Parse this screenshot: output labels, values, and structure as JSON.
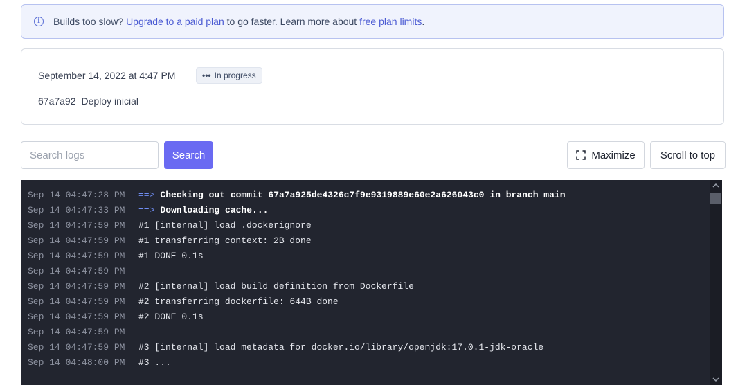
{
  "banner": {
    "prefix": "Builds too slow?",
    "upgrade_link": "Upgrade to a paid plan",
    "middle": "to go faster. Learn more about",
    "limits_link": "free plan limits",
    "suffix": "."
  },
  "deploy": {
    "date": "September 14, 2022 at 4:47 PM",
    "status_dots": "•••",
    "status": "In progress",
    "commit_hash": "67a7a92",
    "commit_message": "Deploy inicial"
  },
  "toolbar": {
    "search_placeholder": "Search logs",
    "search_value": "",
    "search_label": "Search",
    "maximize_label": "Maximize",
    "scroll_top_label": "Scroll to top"
  },
  "logs": [
    {
      "ts": "Sep 14 04:47:28 PM",
      "arrow": "==>",
      "msg": "Checking out commit 67a7a925de4326c7f9e9319889e60e2a626043c0 in branch main",
      "bold": true
    },
    {
      "ts": "Sep 14 04:47:33 PM",
      "arrow": "==>",
      "msg": "Downloading cache...",
      "bold": true
    },
    {
      "ts": "Sep 14 04:47:59 PM",
      "arrow": "",
      "msg": "#1 [internal] load .dockerignore",
      "bold": false
    },
    {
      "ts": "Sep 14 04:47:59 PM",
      "arrow": "",
      "msg": "#1 transferring context: 2B done",
      "bold": false
    },
    {
      "ts": "Sep 14 04:47:59 PM",
      "arrow": "",
      "msg": "#1 DONE 0.1s",
      "bold": false
    },
    {
      "ts": "Sep 14 04:47:59 PM",
      "arrow": "",
      "msg": "",
      "bold": false
    },
    {
      "ts": "Sep 14 04:47:59 PM",
      "arrow": "",
      "msg": "#2 [internal] load build definition from Dockerfile",
      "bold": false
    },
    {
      "ts": "Sep 14 04:47:59 PM",
      "arrow": "",
      "msg": "#2 transferring dockerfile: 644B done",
      "bold": false
    },
    {
      "ts": "Sep 14 04:47:59 PM",
      "arrow": "",
      "msg": "#2 DONE 0.1s",
      "bold": false
    },
    {
      "ts": "Sep 14 04:47:59 PM",
      "arrow": "",
      "msg": "",
      "bold": false
    },
    {
      "ts": "Sep 14 04:47:59 PM",
      "arrow": "",
      "msg": "#3 [internal] load metadata for docker.io/library/openjdk:17.0.1-jdk-oracle",
      "bold": false
    },
    {
      "ts": "Sep 14 04:48:00 PM",
      "arrow": "",
      "msg": "#3 ...",
      "bold": false
    }
  ],
  "icons": {
    "info": "info-circle-icon",
    "maximize": "maximize-icon",
    "status": "ellipsis-icon"
  },
  "colors": {
    "accent": "#6a6af2",
    "link": "#4b5bd3",
    "log_background": "#22252f",
    "banner_background": "#f0f3fd"
  }
}
